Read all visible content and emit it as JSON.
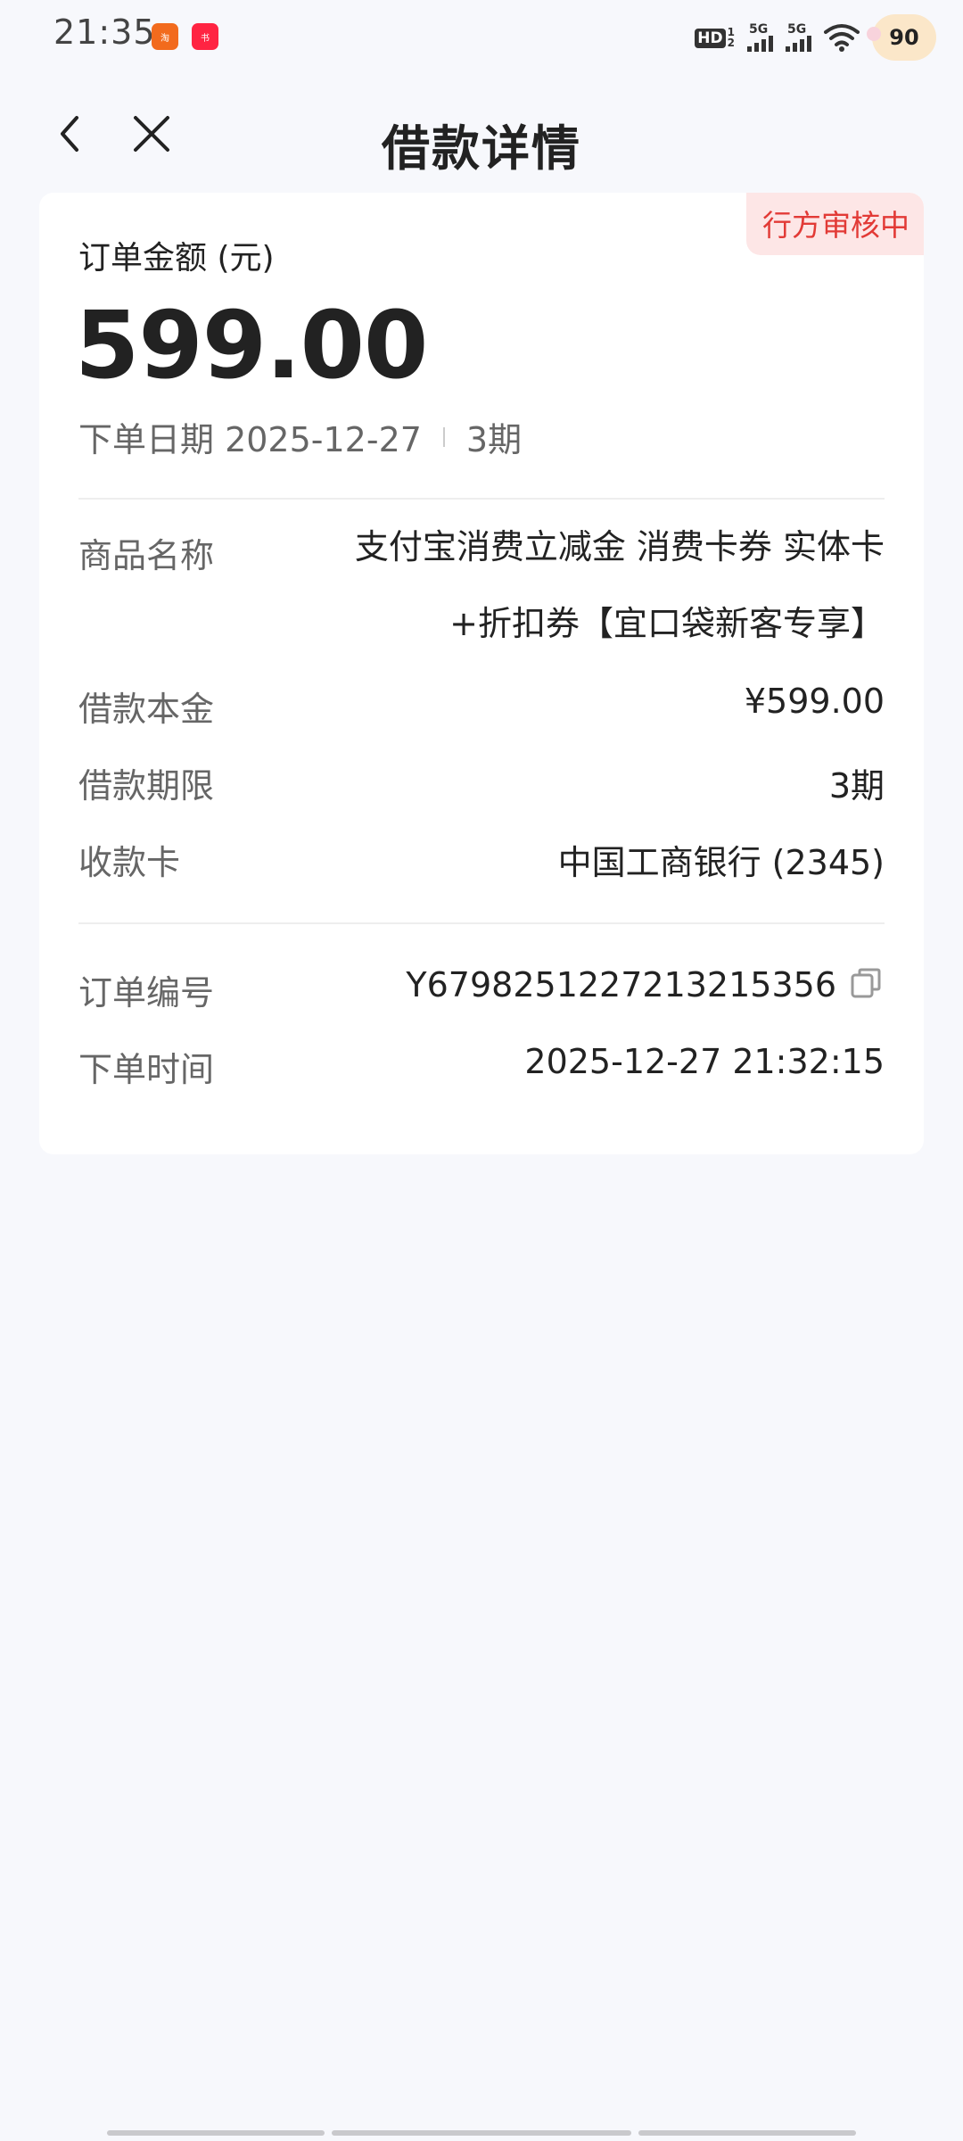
{
  "status_bar": {
    "time": "21:35",
    "app_icons": [
      "taobao-icon",
      "xiaohongshu-icon"
    ],
    "hd_label": "HD",
    "signal1_label": "5G",
    "signal2_label": "5G",
    "battery_pct": "90"
  },
  "header": {
    "title": "借款详情"
  },
  "card": {
    "status_badge": "行方审核中",
    "amount_label": "订单金额 (元)",
    "amount": "599.00",
    "order_date_text": "下单日期 2025-12-27",
    "term_text": "3期",
    "rows": [
      {
        "key": "商品名称",
        "value": "支付宝消费立减金 消费卡券 实体卡+折扣券【宜口袋新客专享】"
      },
      {
        "key": "借款本金",
        "value": "¥599.00"
      },
      {
        "key": "借款期限",
        "value": "3期"
      },
      {
        "key": "收款卡",
        "value": "中国工商银行 (2345)"
      }
    ],
    "order_no_label": "订单编号",
    "order_no": "Y6798251227213215356",
    "order_time_label": "下单时间",
    "order_time": "2025-12-27 21:32:15"
  },
  "colors": {
    "accent_red": "#e23a36",
    "badge_bg": "#fde6e6",
    "page_bg": "#f7f8fc"
  }
}
